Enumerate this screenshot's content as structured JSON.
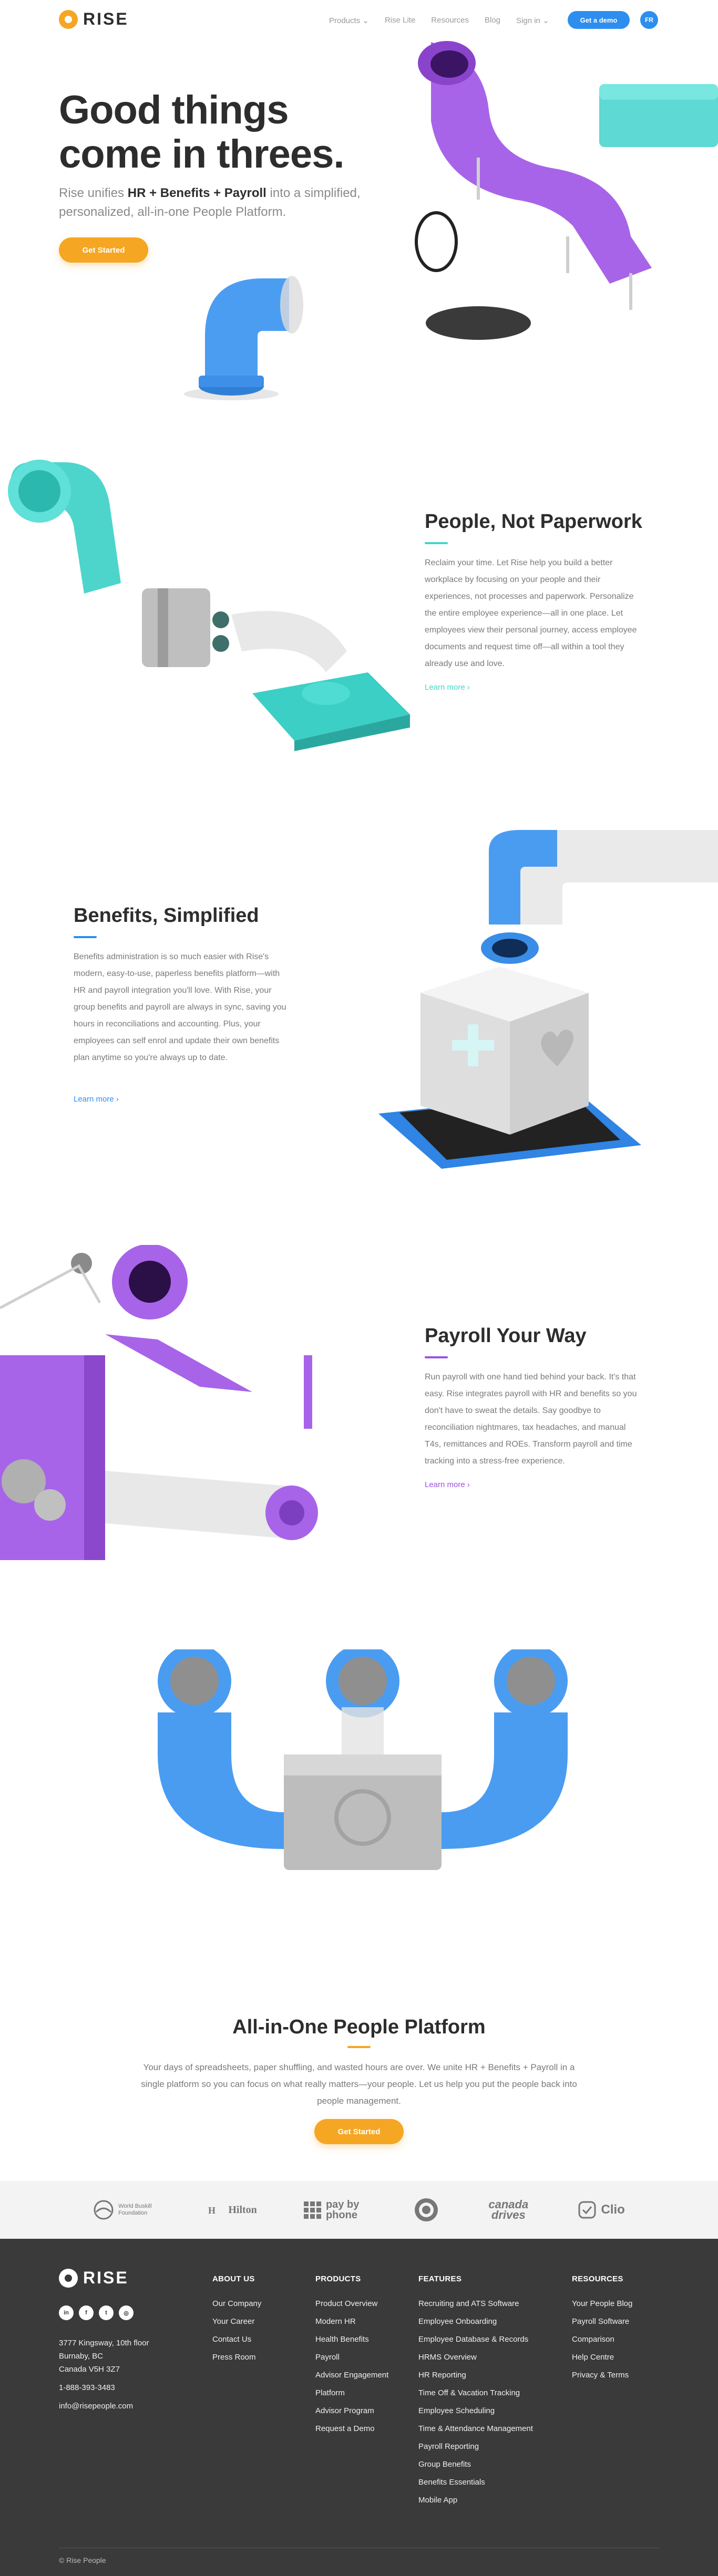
{
  "nav": {
    "logo_text": "RISE",
    "links": [
      "Products ⌄",
      "Rise Lite",
      "Resources",
      "Blog",
      "Sign in ⌄"
    ],
    "demo_label": "Get a demo",
    "lang_label": "FR"
  },
  "hero": {
    "title_line1": "Good things",
    "title_line2": "come in threes.",
    "sub_pre": "Rise unifies ",
    "sub_bold": "HR + Benefits + Payroll",
    "sub_post": " into a simplified, personalized, all-in-one People Platform.",
    "cta": "Get Started"
  },
  "sections": [
    {
      "title": "People, Not Paperwork",
      "body": "Reclaim your time. Let Rise help you build a better workplace by focusing on your people and their experiences, not processes and paperwork. Personalize the entire employee experience—all in one place. Let employees view their personal journey, access employee documents and request time off—all within a tool they already use and love.",
      "link": "Learn more  ›",
      "accent": "#41d6cc"
    },
    {
      "title": "Benefits, Simplified",
      "body": "Benefits administration is so much easier with Rise's modern, easy-to-use, paperless benefits platform—with HR and payroll integration you'll love. With Rise, your group benefits and payroll are always in sync, saving you hours in reconciliations and accounting. Plus, your employees can self enrol and update their own benefits plan anytime so you're always up to date.",
      "link": "Learn more  ›",
      "accent": "#2d8ef0"
    },
    {
      "title": "Payroll Your Way",
      "body": "Run payroll with one hand tied behind your back. It's that easy. Rise integrates payroll with HR and benefits so you don't have to sweat the details. Say goodbye to reconciliation nightmares, tax headaches, and manual T4s, remittances and ROEs. Transform payroll and time tracking into a stress-free experience.",
      "link": "Learn more  ›",
      "accent": "#9b51e0"
    }
  ],
  "platform": {
    "title": "All-in-One People Platform",
    "body": "Your days of spreadsheets, paper shuffling, and wasted hours are over. We unite HR + Benefits + Payroll in a single platform so you can focus on what really matters—your people. Let us help you put the people back into people management.",
    "cta": "Get Started",
    "accent": "#f5a623"
  },
  "clients": [
    {
      "name": "World Buskill Foundation",
      "icon": "globe-icon"
    },
    {
      "name": "Hilton",
      "icon": "hilton-icon"
    },
    {
      "name": "pay by phone",
      "icon": "grid-icon"
    },
    {
      "name": "",
      "icon": "starbucks-icon"
    },
    {
      "name": "canada drives",
      "icon": "wordmark"
    },
    {
      "name": "Clio",
      "icon": "check-icon"
    }
  ],
  "footer": {
    "logo_text": "RISE",
    "social": [
      "in",
      "f",
      "t",
      "◎"
    ],
    "address": [
      "3777 Kingsway, 10th floor",
      "Burnaby, BC",
      "Canada V5H 3Z7"
    ],
    "phone": "1-888-393-3483",
    "email": "info@risepeople.com",
    "columns": [
      {
        "heading": "ABOUT US",
        "items": [
          "Our Company",
          "Your Career",
          "Contact Us",
          "Press Room"
        ]
      },
      {
        "heading": "PRODUCTS",
        "items": [
          "Product Overview",
          "Modern HR",
          "Health Benefits",
          "Payroll",
          "Advisor Engagement",
          "Platform",
          "Advisor Program",
          "Request a Demo"
        ]
      },
      {
        "heading": "FEATURES",
        "items": [
          "Recruiting and ATS Software",
          "Employee Onboarding",
          "Employee Database & Records",
          "HRMS Overview",
          "HR Reporting",
          "Time Off & Vacation Tracking",
          "Employee Scheduling",
          "Time & Attendance Management",
          "Payroll Reporting",
          "Group Benefits",
          "Benefits Essentials",
          "Mobile App"
        ]
      },
      {
        "heading": "RESOURCES",
        "items": [
          "Your People Blog",
          "Payroll Software",
          "Comparison",
          "Help Centre",
          "Privacy & Terms"
        ]
      }
    ],
    "copyright": "© Rise People"
  },
  "colors": {
    "brand_orange": "#f5a623",
    "brand_blue": "#2d8ef0",
    "purple": "#9b51e0",
    "teal": "#41d6cc",
    "footer_bg": "#3a3a3a"
  }
}
